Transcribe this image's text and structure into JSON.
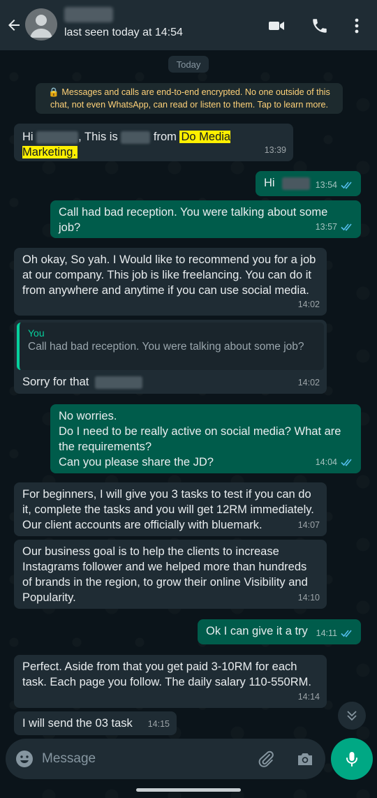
{
  "header": {
    "last_seen": "last seen today at 14:54"
  },
  "date_chip": "Today",
  "encryption_notice": {
    "line1": "🔒 Messages and calls are end-to-end encrypted. No one outside of this",
    "line2": "chat, not even WhatsApp, can read or listen to them. Tap to learn more."
  },
  "messages": [
    {
      "dir": "in",
      "parts": [
        "Hi ",
        ", This is ",
        " from "
      ],
      "highlight": "Do Media Marketing.",
      "time": "13:39"
    },
    {
      "dir": "out",
      "text": "Hi",
      "time": "13:54"
    },
    {
      "dir": "out",
      "text": "Call had bad reception. You were talking about some job?",
      "time": "13:57"
    },
    {
      "dir": "in",
      "text": "Oh okay, So yah. I Would like to recommend you for a job at our company. This job is like freelancing. You can do it from anywhere and anytime if you can use social media.",
      "time": "14:02"
    },
    {
      "dir": "in",
      "quote_author": "You",
      "quote_text": "Call had bad reception. You were talking about some job?",
      "text": "Sorry for that",
      "time": "14:02"
    },
    {
      "dir": "out",
      "lines": [
        "No worries.",
        "Do I need to be really active on social media? What are the requirements?",
        "Can you please share the JD?"
      ],
      "time": "14:04"
    },
    {
      "dir": "in",
      "text": "For beginners, I will give you 3 tasks to test if you can do it, complete the tasks and you will get 12RM immediately. Our client accounts are officially with bluemark.",
      "time": "14:07"
    },
    {
      "dir": "in",
      "text": "Our business goal is to help the clients to increase Instagrams follower and we helped more than hundreds of brands in the region, to grow their online Visibility and Popularity.",
      "time": "14:10"
    },
    {
      "dir": "out",
      "text": "Ok I can give it a try",
      "time": "14:11"
    },
    {
      "dir": "in",
      "text": "Perfect. Aside from that you get paid 3-10RM for each task. Each page you follow. The daily salary 110-550RM.",
      "time": "14:14"
    },
    {
      "dir": "in",
      "text": "I will send the 03 task",
      "time": "14:15"
    }
  ],
  "composer": {
    "placeholder": "Message"
  },
  "colors": {
    "incoming": "#1f2c34",
    "outgoing": "#005c4b",
    "accent": "#00a884",
    "read_ticks": "#53bdeb"
  },
  "icons": [
    "back-arrow-icon",
    "video-call-icon",
    "voice-call-icon",
    "more-options-icon",
    "emoji-icon",
    "attach-icon",
    "camera-icon",
    "mic-icon",
    "double-chevron-down-icon",
    "read-ticks-icon"
  ]
}
